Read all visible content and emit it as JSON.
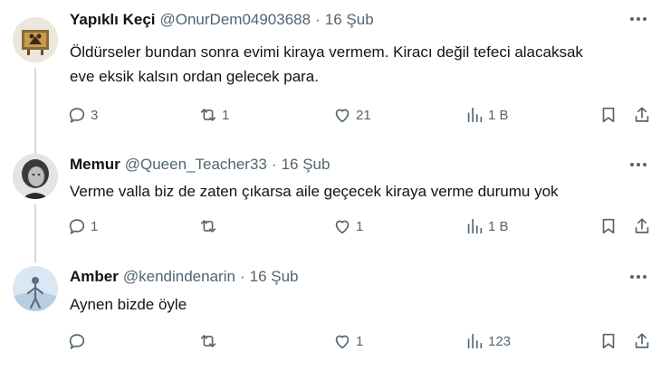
{
  "tweets": [
    {
      "name": "Yapıklı Keçi",
      "handle": "@OnurDem04903688",
      "date": "16 Şub",
      "text_lines": [
        "Öldürseler bundan sonra evimi kiraya vermem. Kiracı değil tefeci alacaksak",
        "eve eksik kalsın ordan gelecek para."
      ],
      "replies": "3",
      "retweets": "1",
      "likes": "21",
      "views": "1 B"
    },
    {
      "name": "Memur",
      "handle": "@Queen_Teacher33",
      "date": "16 Şub",
      "text_lines": [
        "Verme valla biz de zaten çıkarsa aile geçecek kiraya verme durumu yok"
      ],
      "replies": "1",
      "retweets": "",
      "likes": "1",
      "views": "1 B"
    },
    {
      "name": "Amber",
      "handle": "@kendindenarin",
      "date": "16 Şub",
      "text_lines": [
        "Aynen bizde öyle"
      ],
      "replies": "",
      "retweets": "",
      "likes": "1",
      "views": "123"
    }
  ],
  "separator": "·",
  "icons": {
    "more": "more-dots-icon",
    "reply": "reply-bubble-icon",
    "retweet": "retweet-icon",
    "like": "heart-icon",
    "views": "views-bar-icon",
    "bookmark": "bookmark-icon",
    "share": "share-icon"
  },
  "colors": {
    "text": "#0f1419",
    "secondary": "#536471",
    "thread_line": "#cfd9de"
  }
}
